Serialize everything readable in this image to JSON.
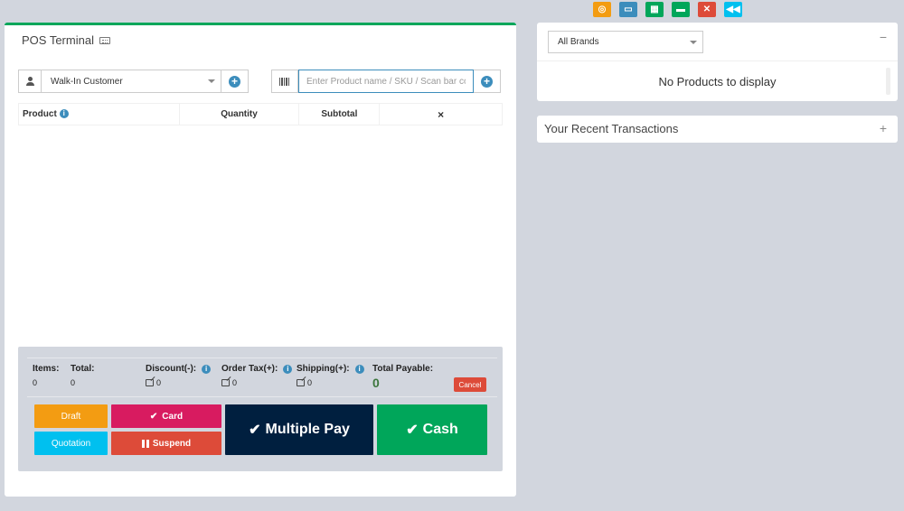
{
  "toolbar": {
    "buttons": [
      {
        "icon": "orange-target-icon",
        "color": "#f39c12"
      },
      {
        "icon": "window-icon",
        "color": "#3c8dbc"
      },
      {
        "icon": "calculator-icon",
        "color": "#00a65a"
      },
      {
        "icon": "briefcase-icon",
        "color": "#00a65a"
      },
      {
        "icon": "close-icon",
        "color": "#dd4b39"
      },
      {
        "icon": "rewind-icon",
        "color": "#00c0ef"
      }
    ]
  },
  "pos": {
    "title": "POS Terminal",
    "customer": "Walk-In Customer",
    "product_placeholder": "Enter Product name / SKU / Scan bar code",
    "columns": {
      "product": "Product",
      "quantity": "Quantity",
      "subtotal": "Subtotal",
      "remove": "×"
    }
  },
  "totals": {
    "items_label": "Items:",
    "items_value": "0",
    "total_label": "Total:",
    "total_value": "0",
    "discount_label": "Discount(-):",
    "discount_value": "0",
    "tax_label": "Order Tax(+):",
    "tax_value": "0",
    "shipping_label": "Shipping(+):",
    "shipping_value": "0",
    "payable_label": "Total Payable:",
    "payable_value": "0",
    "cancel_label": "Cancel"
  },
  "actions": {
    "draft": "Draft",
    "quotation": "Quotation",
    "card": "Card",
    "suspend": "Suspend",
    "multiple_pay": "Multiple Pay",
    "cash": "Cash"
  },
  "products_panel": {
    "brand_filter": "All Brands",
    "empty_text": "No Products to display"
  },
  "recent": {
    "title": "Your Recent Transactions"
  },
  "colors": {
    "accent_green": "#00a65a",
    "primary_blue": "#3c8dbc",
    "danger_red": "#dd4b39",
    "navy": "#001f3f",
    "pink": "#d81b60"
  }
}
